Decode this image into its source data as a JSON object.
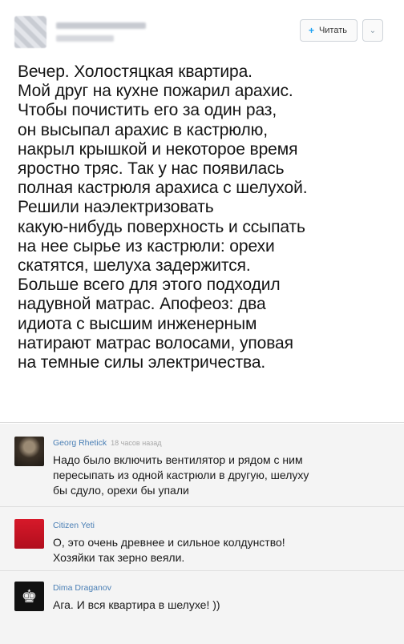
{
  "tweet": {
    "follow_label": "Читать",
    "follow_icon": "+",
    "more_icon": "⌄",
    "lines": [
      "Вечер. Холостяцкая квартира.",
      "Мой друг на кухне пожарил арахис.",
      "Чтобы почистить его за один раз,",
      "он высыпал арахис в кастрюлю,",
      "накрыл крышкой и некоторое время",
      "яростно тряс. Так у нас появилась",
      "полная кастрюля арахиса с шелухой.",
      "Решили наэлектризовать",
      "какую-нибудь поверхность и ссыпать",
      "на нее сырье из кастрюли: орехи",
      "скатятся, шелуха задержится.",
      "Больше всего для этого подходил",
      "надувной матрас. Апофеоз: два",
      "идиота с высшим инженерным",
      "натирают матрас волосами, уповая",
      "на темные силы электричества."
    ]
  },
  "comments": [
    {
      "author": "Georg Rhetick",
      "time": "18 часов назад",
      "lines": [
        "Надо было включить вентилятор и рядом с ним",
        "пересыпать из одной кастрюли в другую, шелуху",
        "бы сдуло, орехи бы упали"
      ]
    },
    {
      "author": "Citizen Yeti",
      "time": "",
      "lines": [
        "О, это очень древнее и сильное колдунство!",
        "Хозяйки так зерно веяли."
      ]
    },
    {
      "author": "Dima Draganov",
      "time": "",
      "lines": [
        "Ага. И вся квартира в шелухе! ))"
      ]
    }
  ]
}
